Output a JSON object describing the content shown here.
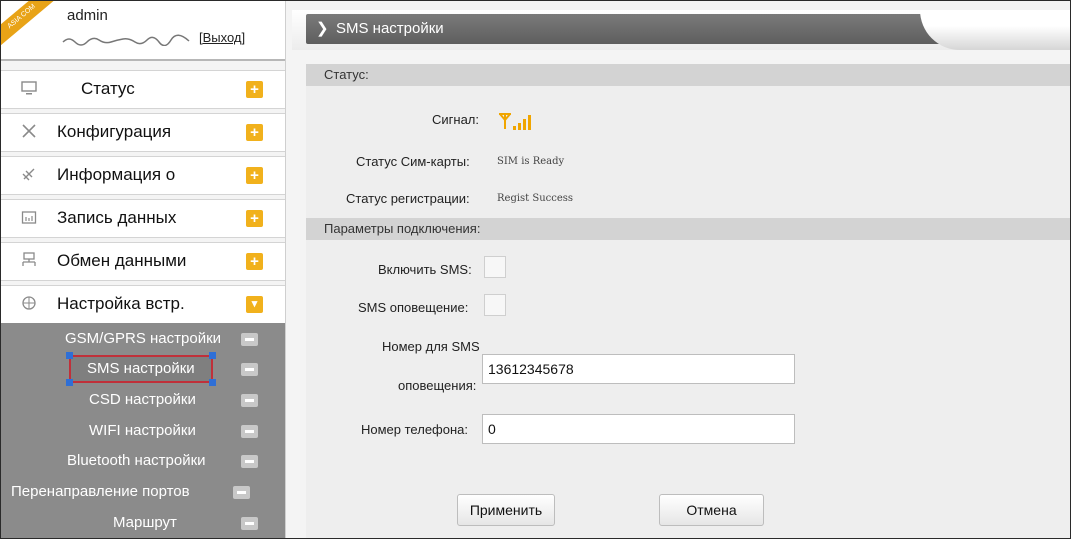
{
  "user": {
    "ribbon_text": "ASIA COM",
    "username": "admin",
    "logout_label": "[Выход]"
  },
  "sidebar": {
    "items": [
      {
        "label": "Статус",
        "icon": "monitor-icon",
        "expand": "+"
      },
      {
        "label": "Конфигурация",
        "icon": "tools-icon",
        "expand": "+"
      },
      {
        "label": "Информация о",
        "icon": "satellite-icon",
        "expand": "+"
      },
      {
        "label": "Запись данных",
        "icon": "calendar-icon",
        "expand": "+"
      },
      {
        "label": "Обмен данными",
        "icon": "network-icon",
        "expand": "+"
      },
      {
        "label": "Настройка встр.",
        "icon": "globe-icon",
        "expand": "▾"
      }
    ],
    "subitems": [
      {
        "label": "GSM/GPRS настройки"
      },
      {
        "label": "SMS настройки",
        "selected": true
      },
      {
        "label": "CSD настройки"
      },
      {
        "label": "WIFI настройки"
      },
      {
        "label": "Bluetooth настройки"
      },
      {
        "label": "Перенаправление портов"
      },
      {
        "label": "Маршрут"
      }
    ]
  },
  "main": {
    "title": "SMS настройки",
    "status_section": {
      "heading": "Статус:",
      "signal_label": "Сигнал:",
      "signal_icon": "signal-strength-icon",
      "sim_label": "Статус Сим-карты:",
      "sim_value": "SIM is Ready",
      "reg_label": "Статус регистрации:",
      "reg_value": "Regist Success"
    },
    "params_section": {
      "heading": "Параметры подключения:",
      "enable_sms_label": "Включить SMS:",
      "sms_alert_label": "SMS оповещение:",
      "alert_number_label_1": "Номер для SMS",
      "alert_number_label_2": "оповещения:",
      "alert_number_value": "13612345678",
      "phone_label": "Номер телефона:",
      "phone_value": "0"
    },
    "apply_label": "Применить",
    "cancel_label": "Отмена"
  },
  "colors": {
    "accent_plus": "#f1b11c",
    "selection_border": "#c0303a",
    "signal": "#f0a500"
  }
}
